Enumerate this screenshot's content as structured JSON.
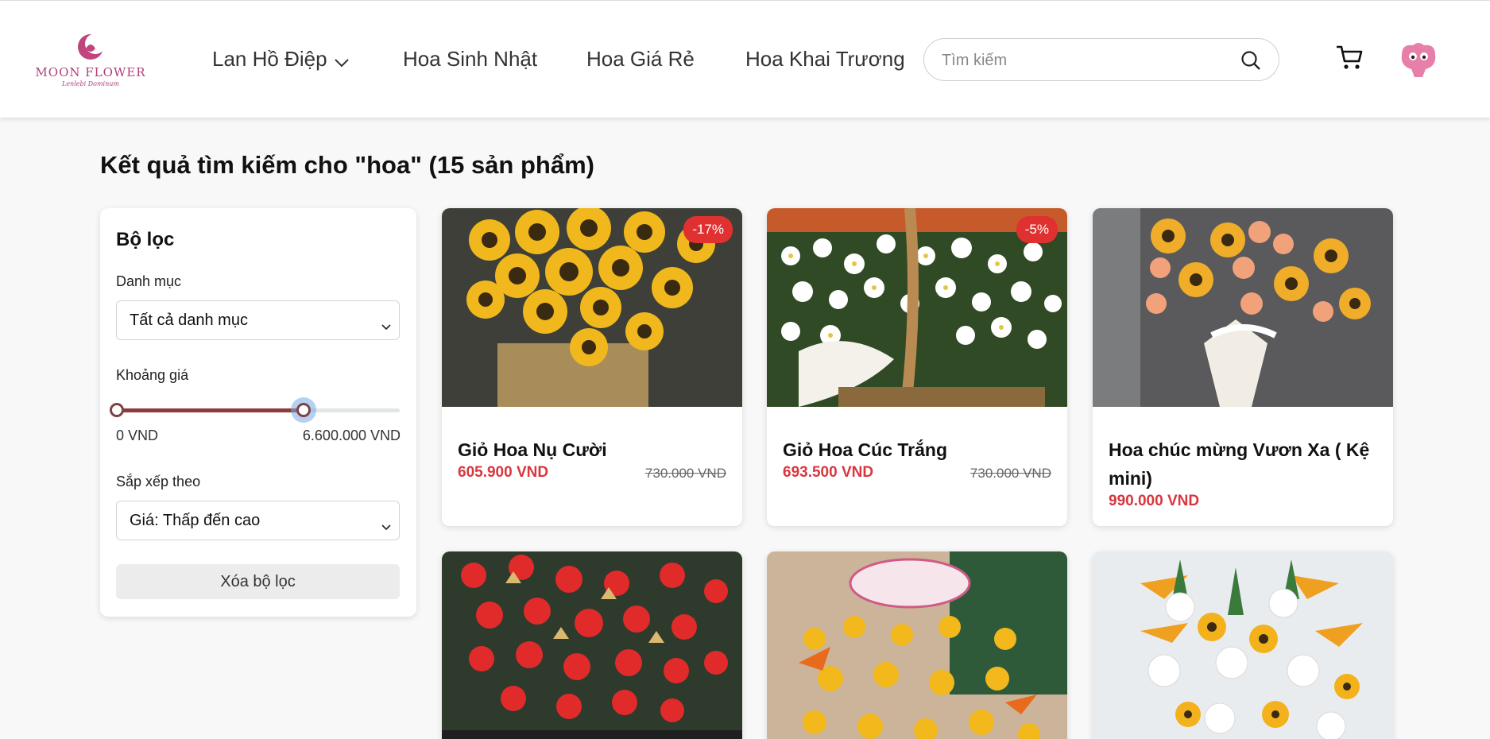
{
  "brand": {
    "name": "MOON FLOWER",
    "tagline": "Lenlebi Dominum",
    "color": "#b0407a"
  },
  "nav": {
    "items": [
      {
        "label": "Lan Hồ Điệp",
        "has_dropdown": true
      },
      {
        "label": "Hoa Sinh Nhật"
      },
      {
        "label": "Hoa Giá Rẻ"
      },
      {
        "label": "Hoa Khai Trương"
      }
    ]
  },
  "search": {
    "placeholder": "Tìm kiếm",
    "value": ""
  },
  "results_title": "Kết quả tìm kiếm cho \"hoa\" (15 sản phẩm)",
  "filter": {
    "title": "Bộ lọc",
    "category_label": "Danh mục",
    "category_value": "Tất cả danh mục",
    "price_label": "Khoảng giá",
    "price_min": "0 VND",
    "price_max": "6.600.000 VND",
    "price_range_fraction": 0.66,
    "sort_label": "Sắp xếp theo",
    "sort_value": "Giá: Thấp đến cao",
    "clear_label": "Xóa bộ lọc"
  },
  "products": [
    {
      "name": "Giỏ Hoa Nụ Cười",
      "price": "605.900 VND",
      "old_price": "730.000 VND",
      "discount": "-17%",
      "image": "sunflower-basket"
    },
    {
      "name": "Giỏ Hoa Cúc Trắng",
      "price": "693.500 VND",
      "old_price": "730.000 VND",
      "discount": "-5%",
      "image": "white-daisy-basket"
    },
    {
      "name": "Hoa chúc mừng Vươn Xa ( Kệ mini)",
      "price": "990.000 VND",
      "old_price": "",
      "discount": "",
      "image": "congrats-stand"
    },
    {
      "image": "red-rose-arrangement"
    },
    {
      "image": "yellow-orchid-stand"
    },
    {
      "image": "bird-of-paradise-arrangement"
    }
  ],
  "colors": {
    "accent_red": "#d9363e",
    "badge_red": "#e03131",
    "slider_fill": "#8b3b3b"
  }
}
